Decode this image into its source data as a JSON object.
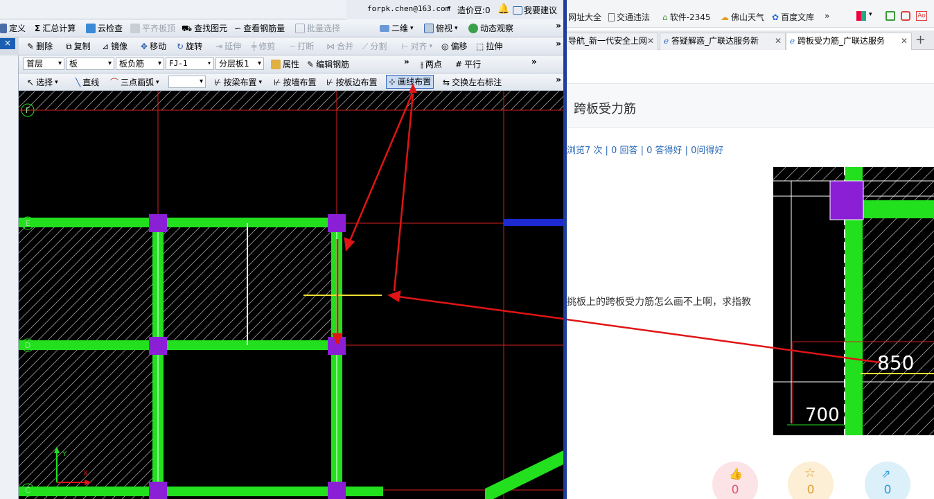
{
  "topbar": {
    "email": "forpk.chen@163.com",
    "price_label": "造价豆:0",
    "feedback": "我要建议"
  },
  "toolbar1": {
    "items": [
      "定义",
      "汇总计算",
      "云检查",
      "平齐板顶",
      "查找图元",
      "查看钢筋量",
      "批量选择",
      "二维",
      "俯视",
      "动态观察"
    ]
  },
  "toolbar2": {
    "items": [
      "删除",
      "复制",
      "镜像",
      "移动",
      "旋转",
      "延伸",
      "修剪",
      "打断",
      "合并",
      "分割",
      "对齐",
      "偏移",
      "拉伸"
    ]
  },
  "toolbar3": {
    "floor": "首层",
    "category": "板",
    "type": "板负筋",
    "name": "FJ-1",
    "layer": "分层板1",
    "props": "属性",
    "edit": "编辑钢筋",
    "twopoint": "两点",
    "parallel": "平行"
  },
  "toolbar4": {
    "items": [
      "选择",
      "直线",
      "三点画弧",
      "按梁布置",
      "按墙布置",
      "按板边布置",
      "画线布置",
      "交换左右标注"
    ]
  },
  "canvas": {
    "axis_labels": [
      "F",
      "E",
      "D",
      "C"
    ],
    "ucs_x": "X",
    "ucs_y": "Y"
  },
  "browser": {
    "favorites": [
      "网址大全",
      "交通违法",
      "软件-2345",
      "佛山天气",
      "百度文库"
    ],
    "tabs": [
      "导航_新一代安全上网",
      "答疑解惑_广联达服务新",
      "跨板受力筋_广联达服务"
    ],
    "question_title": "跨板受力筋",
    "stats": "浏览7 次 | 0 回答 | 0 答得好 | 0问得好",
    "question_text": "挑板上的跨板受力筋怎么画不上啊，求指教",
    "thumb_labels": [
      "850",
      "700"
    ],
    "actions": [
      {
        "icon": "thumb-up-icon",
        "count": "0",
        "color": "#e0566a",
        "bg": "#fbe3e6"
      },
      {
        "icon": "star-icon",
        "count": "0",
        "color": "#e0a23a",
        "bg": "#fcefd6"
      },
      {
        "icon": "share-icon",
        "count": "0",
        "color": "#2c9bd6",
        "bg": "#dcf0fa"
      }
    ]
  },
  "colors": {
    "beam": "#22e01e",
    "column": "#8a1fd6",
    "axis": "#d62020",
    "arrow": "#e01414",
    "rebar": "#f0e030"
  }
}
